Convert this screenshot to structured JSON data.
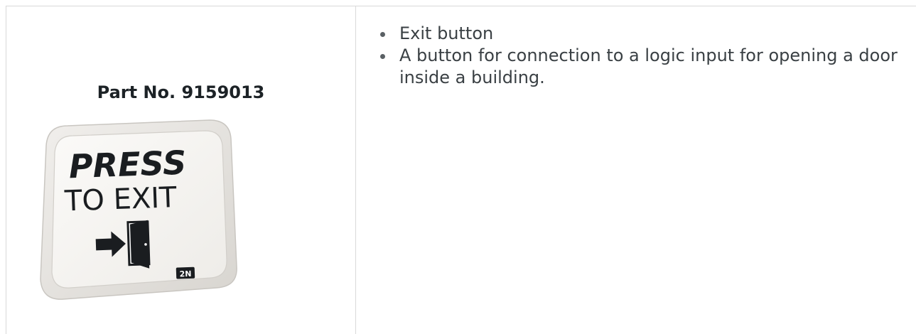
{
  "product": {
    "part_number": "Part No. 9159013",
    "image": {
      "icon": "exit-button-photo-icon",
      "label_line1": "PRESS",
      "label_line2": "TO EXIT",
      "brand": "2N",
      "colors": {
        "plate": "#e9e7e3",
        "face": "#f7f6f3",
        "text": "#1a1d20"
      }
    }
  },
  "features": [
    "Exit button",
    "A button for connection to a logic input for opening a door inside a building."
  ]
}
